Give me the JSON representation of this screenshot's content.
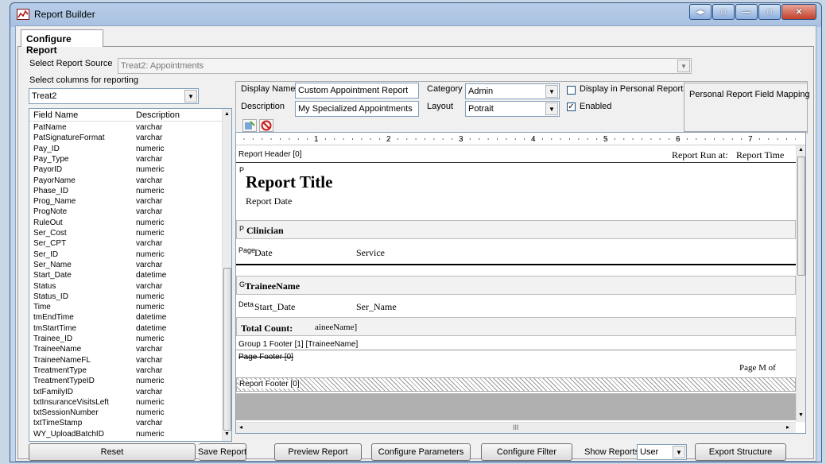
{
  "window": {
    "title": "Report Builder"
  },
  "tab": {
    "label": "Configure Report"
  },
  "source": {
    "label": "Select Report Source",
    "value": "Treat2: Appointments"
  },
  "columns": {
    "group_label": "Select columns for reporting",
    "table_value": "Treat2",
    "headers": {
      "field": "Field Name",
      "desc": "Description"
    },
    "rows": [
      [
        "PatName",
        "varchar"
      ],
      [
        "PatSignatureFormat",
        "varchar"
      ],
      [
        "Pay_ID",
        "numeric"
      ],
      [
        "Pay_Type",
        "varchar"
      ],
      [
        "PayorID",
        "numeric"
      ],
      [
        "PayorName",
        "varchar"
      ],
      [
        "Phase_ID",
        "numeric"
      ],
      [
        "Prog_Name",
        "varchar"
      ],
      [
        "ProgNote",
        "varchar"
      ],
      [
        "RuleOut",
        "numeric"
      ],
      [
        "Ser_Cost",
        "numeric"
      ],
      [
        "Ser_CPT",
        "varchar"
      ],
      [
        "Ser_ID",
        "numeric"
      ],
      [
        "Ser_Name",
        "varchar"
      ],
      [
        "Start_Date",
        "datetime"
      ],
      [
        "Status",
        "varchar"
      ],
      [
        "Status_ID",
        "numeric"
      ],
      [
        "Time",
        "numeric"
      ],
      [
        "tmEndTime",
        "datetime"
      ],
      [
        "tmStartTime",
        "datetime"
      ],
      [
        "Trainee_ID",
        "numeric"
      ],
      [
        "TraineeName",
        "varchar"
      ],
      [
        "TraineeNameFL",
        "varchar"
      ],
      [
        "TreatmentType",
        "varchar"
      ],
      [
        "TreatmentTypeID",
        "numeric"
      ],
      [
        "txtFamilyID",
        "varchar"
      ],
      [
        "txtInsuranceVisitsLeft",
        "numeric"
      ],
      [
        "txtSessionNumber",
        "numeric"
      ],
      [
        "txtTimeStamp",
        "varchar"
      ],
      [
        "WY_UploadBatchID",
        "numeric"
      ]
    ]
  },
  "form": {
    "display_name_label": "Display Name",
    "display_name_value": "Custom Appointment Report",
    "category_label": "Category",
    "category_value": "Admin",
    "display_personal_label": "Display in Personal Reports",
    "personal_mapping_label": "Personal Report Field Mapping",
    "description_label": "Description",
    "description_value": "My Specialized Appointments",
    "layout_label": "Layout",
    "layout_value": "Potrait",
    "enabled_label": "Enabled"
  },
  "ruler": [
    "1",
    "2",
    "3",
    "4",
    "5",
    "6",
    "7"
  ],
  "designer": {
    "report_header": "Report Header [0]",
    "report_run_at": "Report Run at:",
    "report_time": "Report Time",
    "report_title": "Report Title",
    "report_date": "Report Date",
    "ph_letter": "P",
    "clinician": "Clinician",
    "page_prefix": "Page",
    "date": "Date",
    "service": "Service",
    "g_prefix": "G",
    "trainee_name": "TraineeName",
    "det_prefix": "Deta",
    "start_date": "Start_Date",
    "ser_name": "Ser_Name",
    "total_count": "Total Count:",
    "trainee_frag": "aineeName]",
    "group_footer": "Group 1 Footer [1] [TraineeName]",
    "page_footer": "Page Footer [0]",
    "page_m_of": "Page M of",
    "report_footer": "Report Footer [0]",
    "hscroll_mark": "III"
  },
  "buttons": {
    "reset": "Reset",
    "save": "Save Report",
    "preview": "Preview Report",
    "params": "Configure Parameters",
    "filter": "Configure Filter",
    "show_reports_label": "Show Reports",
    "show_reports_value": "User",
    "export": "Export Structure"
  }
}
